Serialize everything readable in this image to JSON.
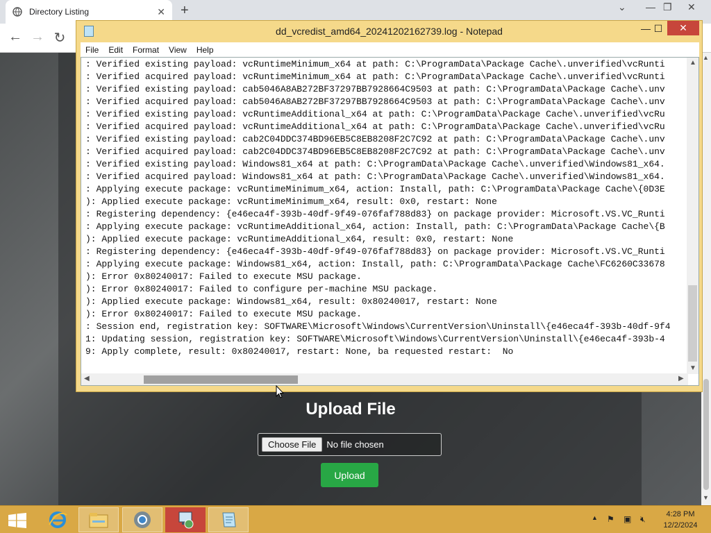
{
  "browser": {
    "tab_title": "Directory Listing",
    "tab_close": "✕",
    "new_tab": "+",
    "controls": {
      "minimize": "—",
      "maximize": "❐",
      "close": "✕",
      "chevron": "⌄"
    },
    "nav": {
      "back": "←",
      "forward": "→",
      "reload": "↻"
    }
  },
  "page": {
    "heading": "Upload File",
    "choose_file_label": "Choose File",
    "no_file_text": "No file chosen",
    "upload_label": "Upload"
  },
  "notepad": {
    "title": "dd_vcredist_amd64_20241202162739.log - Notepad",
    "controls": {
      "minimize": "—",
      "maximize": "☐",
      "close": "✕"
    },
    "menu": [
      "File",
      "Edit",
      "Format",
      "View",
      "Help"
    ],
    "lines": [
      ": Verified existing payload: vcRuntimeMinimum_x64 at path: C:\\ProgramData\\Package Cache\\.unverified\\vcRunti",
      ": Verified acquired payload: vcRuntimeMinimum_x64 at path: C:\\ProgramData\\Package Cache\\.unverified\\vcRunti",
      ": Verified existing payload: cab5046A8AB272BF37297BB7928664C9503 at path: C:\\ProgramData\\Package Cache\\.unv",
      ": Verified acquired payload: cab5046A8AB272BF37297BB7928664C9503 at path: C:\\ProgramData\\Package Cache\\.unv",
      ": Verified existing payload: vcRuntimeAdditional_x64 at path: C:\\ProgramData\\Package Cache\\.unverified\\vcRu",
      ": Verified acquired payload: vcRuntimeAdditional_x64 at path: C:\\ProgramData\\Package Cache\\.unverified\\vcRu",
      ": Verified existing payload: cab2C04DDC374BD96EB5C8EB8208F2C7C92 at path: C:\\ProgramData\\Package Cache\\.unv",
      ": Verified acquired payload: cab2C04DDC374BD96EB5C8EB8208F2C7C92 at path: C:\\ProgramData\\Package Cache\\.unv",
      ": Verified existing payload: Windows81_x64 at path: C:\\ProgramData\\Package Cache\\.unverified\\Windows81_x64.",
      ": Verified acquired payload: Windows81_x64 at path: C:\\ProgramData\\Package Cache\\.unverified\\Windows81_x64.",
      ": Applying execute package: vcRuntimeMinimum_x64, action: Install, path: C:\\ProgramData\\Package Cache\\{0D3E",
      "): Applied execute package: vcRuntimeMinimum_x64, result: 0x0, restart: None",
      ": Registering dependency: {e46eca4f-393b-40df-9f49-076faf788d83} on package provider: Microsoft.VS.VC_Runti",
      ": Applying execute package: vcRuntimeAdditional_x64, action: Install, path: C:\\ProgramData\\Package Cache\\{B",
      "): Applied execute package: vcRuntimeAdditional_x64, result: 0x0, restart: None",
      ": Registering dependency: {e46eca4f-393b-40df-9f49-076faf788d83} on package provider: Microsoft.VS.VC_Runti",
      ": Applying execute package: Windows81_x64, action: Install, path: C:\\ProgramData\\Package Cache\\FC6260C33678",
      "): Error 0x80240017: Failed to execute MSU package.",
      "): Error 0x80240017: Failed to configure per-machine MSU package.",
      "): Applied execute package: Windows81_x64, result: 0x80240017, restart: None",
      "): Error 0x80240017: Failed to execute MSU package.",
      ": Session end, registration key: SOFTWARE\\Microsoft\\Windows\\CurrentVersion\\Uninstall\\{e46eca4f-393b-40df-9f4",
      "1: Updating session, registration key: SOFTWARE\\Microsoft\\Windows\\CurrentVersion\\Uninstall\\{e46eca4f-393b-4",
      "9: Apply complete, result: 0x80240017, restart: None, ba requested restart:  No"
    ]
  },
  "taskbar": {
    "clock_time": "4:28 PM",
    "clock_date": "12/2/2024"
  }
}
